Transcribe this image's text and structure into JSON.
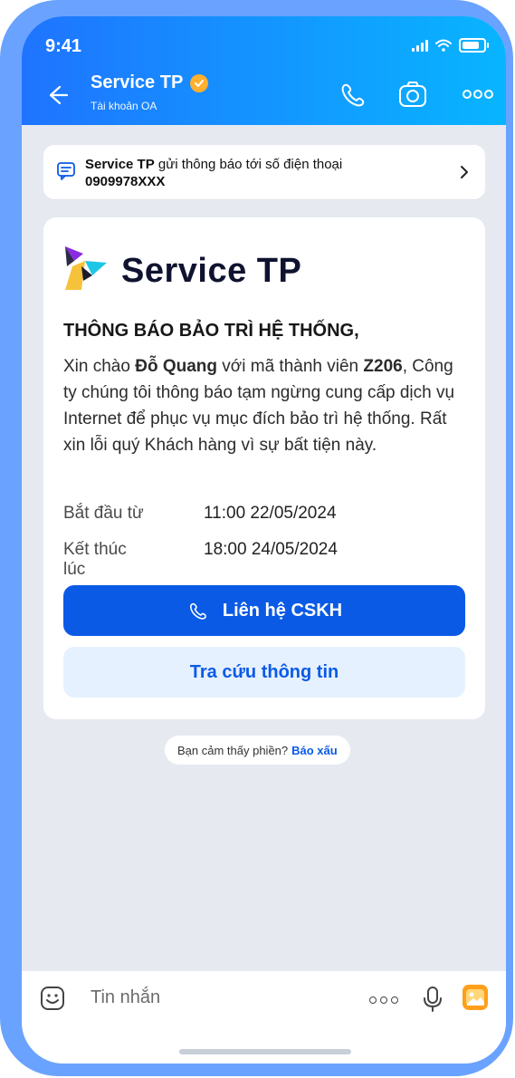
{
  "status": {
    "time": "9:41"
  },
  "header": {
    "title": "Service TP",
    "subtitle": "Tài khoản OA"
  },
  "notice": {
    "prefix_bold": "Service TP",
    "text": " gửi thông báo tới số điện thoại",
    "phone": "0909978XXX"
  },
  "card": {
    "brand": "Service TP",
    "heading": "THÔNG BÁO BẢO TRÌ HỆ THỐNG,",
    "greeting_prefix": "Xin chào ",
    "customer_name": "Đỗ Quang",
    "greeting_mid": " với mã thành viên ",
    "member_code": "Z206",
    "greeting_suffix": ",",
    "message": "Công ty chúng tôi thông báo tạm ngừng cung cấp dịch vụ Internet để phục vụ mục đích bảo trì hệ thống. Rất xin lỗi quý Khách hàng vì sự bất tiện này.",
    "start_label": "Bắt đầu từ",
    "start_value": "11:00 22/05/2024",
    "end_label": "Kết thúc lúc",
    "end_value": "18:00 24/05/2024",
    "primary_button": "Liên hệ CSKH",
    "secondary_button": "Tra cứu thông tin"
  },
  "feedback": {
    "text": "Bạn cảm thấy phiền?",
    "link": "Báo xấu"
  },
  "composer": {
    "placeholder": "Tin nhắn"
  },
  "icons": {
    "back": "arrow-left-icon",
    "verified": "verified-badge-icon",
    "call": "phone-icon",
    "camera": "camera-icon",
    "more": "more-icon",
    "notice": "message-icon",
    "chevron": "chevron-right-icon",
    "emoji": "emoji-icon",
    "mic": "mic-icon",
    "image": "image-icon"
  },
  "colors": {
    "primary": "#0a5ae6",
    "header_start": "#1f74ff",
    "header_end": "#08b5ff",
    "verified": "#ffb02e"
  }
}
